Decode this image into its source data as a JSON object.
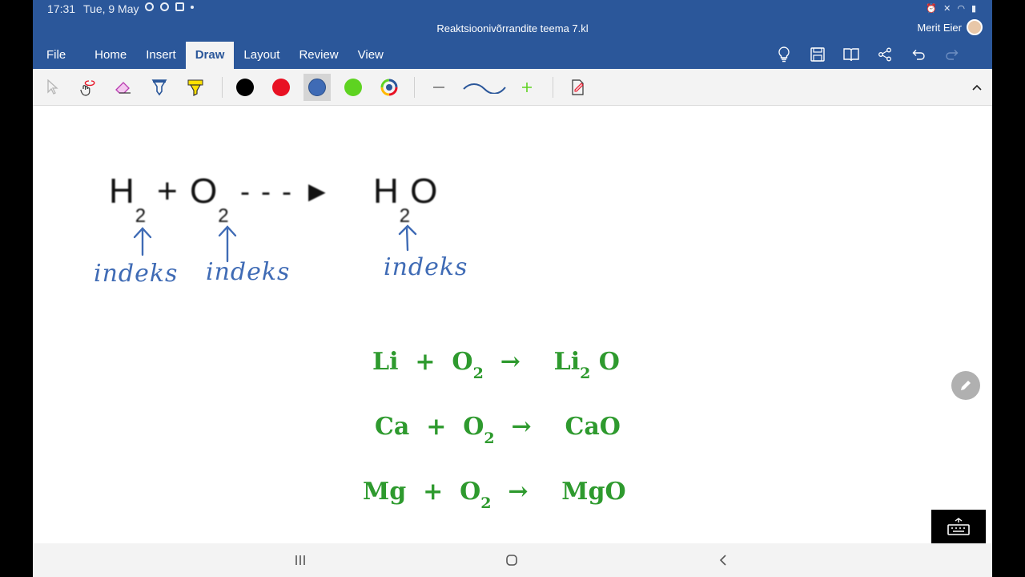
{
  "status_bar": {
    "time": "17:31",
    "date": "Tue, 9 May"
  },
  "window": {
    "title": "Reaktsioonivõrrandite teema 7.kl",
    "user_name": "Merit Eier"
  },
  "tabs": [
    {
      "label": "File",
      "active": false
    },
    {
      "label": "Home",
      "active": false
    },
    {
      "label": "Insert",
      "active": false
    },
    {
      "label": "Draw",
      "active": true
    },
    {
      "label": "Layout",
      "active": false
    },
    {
      "label": "Review",
      "active": false
    },
    {
      "label": "View",
      "active": false
    }
  ],
  "ribbon_icons": [
    "lightbulb-icon",
    "save-icon",
    "reading-view-icon",
    "share-icon",
    "undo-icon",
    "redo-icon"
  ],
  "draw_toolbar": {
    "tools": [
      "select-icon",
      "lasso-icon",
      "eraser-icon",
      "pen-icon",
      "highlighter-icon"
    ],
    "pen_colors": [
      {
        "name": "black",
        "hex": "#000000",
        "selected": false
      },
      {
        "name": "red",
        "hex": "#E81123",
        "selected": false
      },
      {
        "name": "blue",
        "hex": "#3F6BB5",
        "selected": true
      },
      {
        "name": "green",
        "hex": "#5ED321",
        "selected": false
      },
      {
        "name": "multicolor",
        "hex": "#FFFFFF",
        "selected": false
      }
    ],
    "stroke_tools": [
      "thinner-icon",
      "stroke-preview",
      "thicker-icon"
    ],
    "convert_tool": "ink-to-shape-icon"
  },
  "canvas": {
    "image_equation": {
      "left": [
        "H",
        "2"
      ],
      "plus": "+",
      "middle": [
        "O",
        "2"
      ],
      "arrow": "- - - ►",
      "right": [
        "H",
        "2",
        "O"
      ]
    },
    "annotations": [
      "indeks",
      "indeks",
      "indeks"
    ],
    "reactions": [
      {
        "r1": "Li",
        "plus": "+",
        "r2": "O",
        "r2_sub": "2",
        "arrow": "→",
        "p": "Li",
        "p_sub": "2",
        "p_tail": "O"
      },
      {
        "r1": "Ca",
        "plus": "+",
        "r2": "O",
        "r2_sub": "2",
        "arrow": "→",
        "p": "CaO",
        "p_sub": "",
        "p_tail": ""
      },
      {
        "r1": "Mg",
        "plus": "+",
        "r2": "O",
        "r2_sub": "2",
        "arrow": "→",
        "p": "MgO",
        "p_sub": "",
        "p_tail": ""
      }
    ],
    "ink_color": "#3F6BB5",
    "formula_color": "#2E9A2E"
  }
}
